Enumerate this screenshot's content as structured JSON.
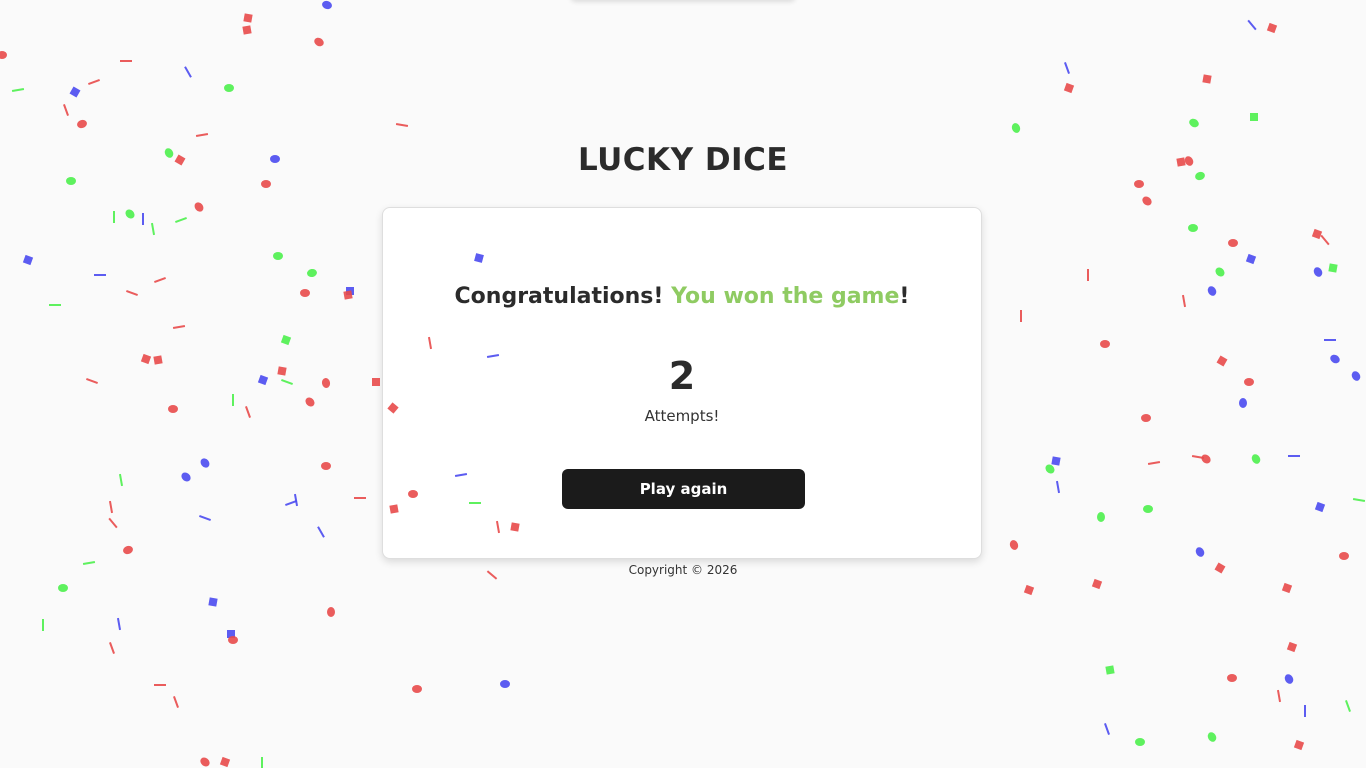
{
  "app": {
    "title": "LUCKY DICE"
  },
  "result": {
    "congrats_prefix": "Congratulations! ",
    "congrats_highlight": "You won the game",
    "congrats_suffix": "!",
    "attempts": "2",
    "attempts_label": "Attempts!",
    "play_again_label": "Play again"
  },
  "footer": {
    "copyright": "Copyright © 2026"
  },
  "colors": {
    "background": "#fafafa",
    "card": "#ffffff",
    "highlight": "#8fcb62",
    "button": "#1b1b1b",
    "confetti_red": "#e84a4a",
    "confetti_green": "#4cf04c",
    "confetti_blue": "#4a4af0"
  }
}
